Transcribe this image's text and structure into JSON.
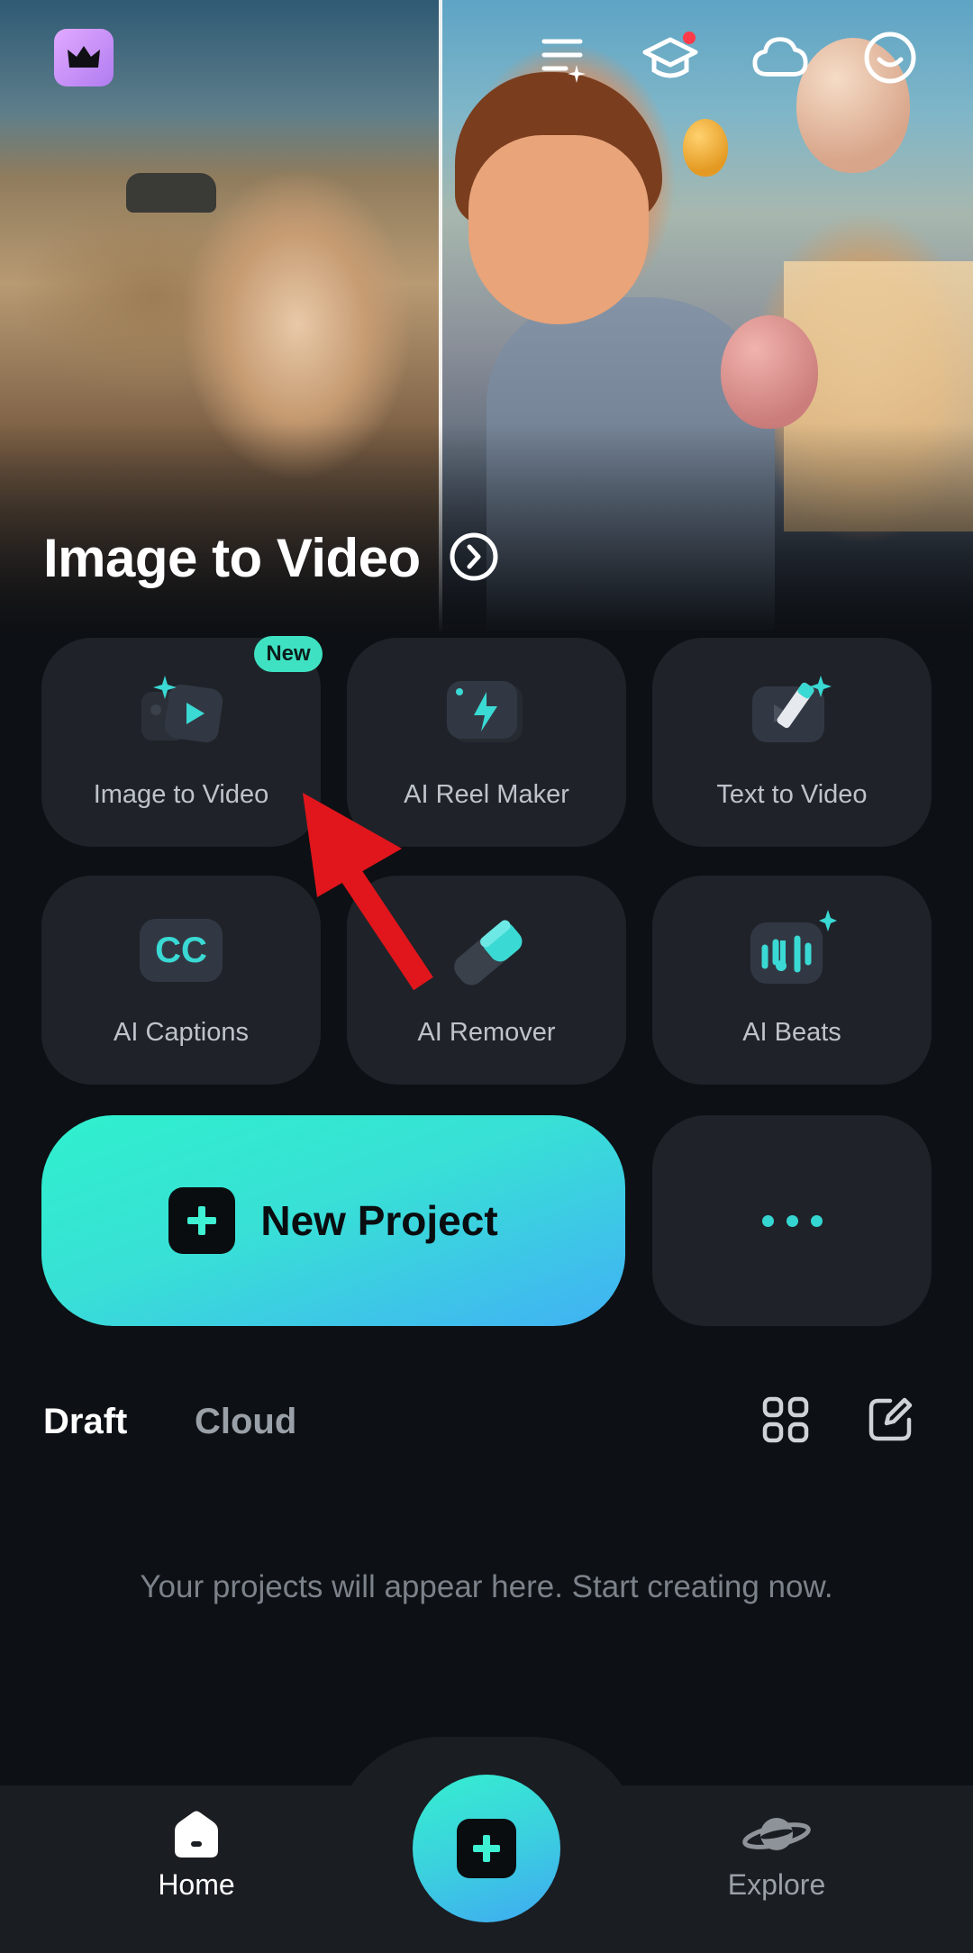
{
  "hero": {
    "title": "Image to Video"
  },
  "top_icons": [
    "crown-icon",
    "list-sparkle-icon",
    "graduation-cap-icon",
    "cloud-icon",
    "smile-face-icon"
  ],
  "features": [
    {
      "label": "Image to Video",
      "badge": "New",
      "icon": "image-to-video-icon"
    },
    {
      "label": "AI Reel Maker",
      "icon": "lightning-icon"
    },
    {
      "label": "Text to Video",
      "icon": "pencil-video-icon"
    },
    {
      "label": "AI Captions",
      "icon": "cc-icon"
    },
    {
      "label": "AI Remover",
      "icon": "eraser-icon"
    },
    {
      "label": "AI Beats",
      "icon": "music-beats-icon"
    }
  ],
  "new_project": {
    "label": "New Project"
  },
  "tabs": {
    "draft": "Draft",
    "cloud": "Cloud"
  },
  "empty_state": "Your projects will appear here. Start creating now.",
  "bottom_nav": {
    "home": "Home",
    "explore": "Explore"
  },
  "colors": {
    "accent": "#35e6d0",
    "background": "#0d1014",
    "tile": "#1f2329",
    "annotation_arrow": "#e0161c"
  }
}
